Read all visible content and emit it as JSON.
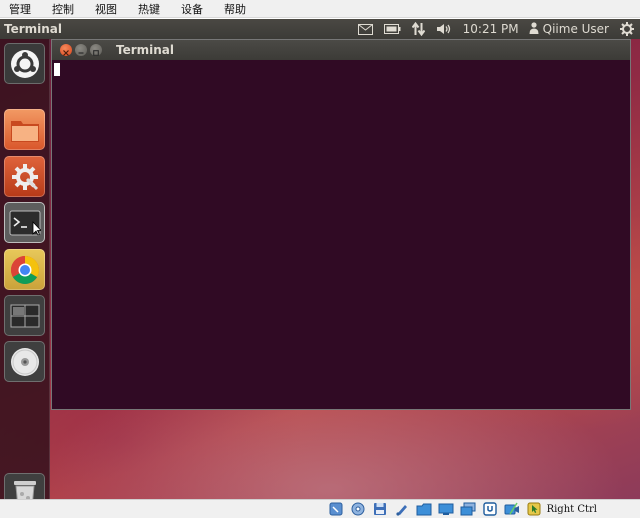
{
  "host": {
    "menu": [
      {
        "label": "管理",
        "name": "host-menu-manage"
      },
      {
        "label": "控制",
        "name": "host-menu-control"
      },
      {
        "label": "视图",
        "name": "host-menu-view"
      },
      {
        "label": "热键",
        "name": "host-menu-hotkeys"
      },
      {
        "label": "设备",
        "name": "host-menu-devices"
      },
      {
        "label": "帮助",
        "name": "host-menu-help"
      }
    ],
    "status_icons": [
      "hard-disk-icon",
      "optical-drive-icon",
      "floppy-icon",
      "audio-icon",
      "network-icon",
      "shared-folders-icon",
      "display-icon",
      "usb-icon",
      "recording-icon",
      "mouse-integration-icon"
    ],
    "host_key": "Right Ctrl"
  },
  "panel": {
    "title": "Terminal",
    "clock": "10:21 PM",
    "user": "Qiime User",
    "indicators": [
      "mail-icon",
      "battery-icon",
      "network-transfer-icon",
      "volume-icon"
    ]
  },
  "launcher": {
    "items": [
      "dash-home",
      "files",
      "system-settings",
      "terminal",
      "chrome",
      "workspace-switcher",
      "dvd-drive",
      "trash"
    ]
  },
  "window": {
    "title": "Terminal"
  },
  "colors": {
    "terminal_bg": "#300a24",
    "panel_bg": "#3c3b37",
    "close_button": "#e0562a"
  }
}
